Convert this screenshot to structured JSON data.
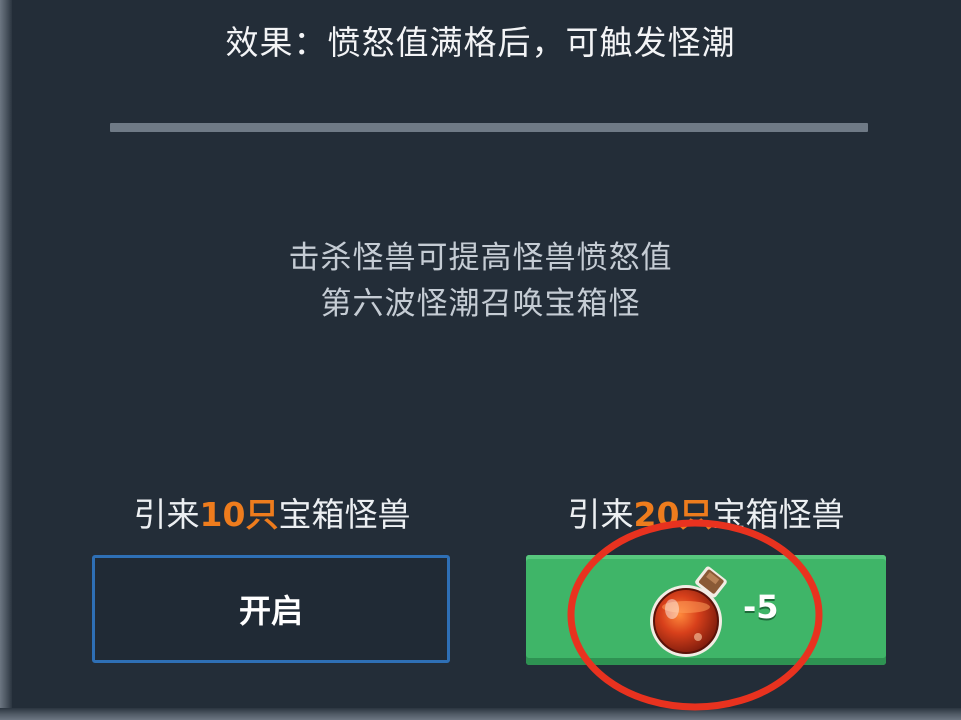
{
  "effect_text": "效果：愤怒值满格后，可触发怪潮",
  "description": {
    "line1": "击杀怪兽可提高怪兽愤怒值",
    "line2": "第六波怪潮召唤宝箱怪"
  },
  "option_left": {
    "prefix": "引来",
    "count": "10只",
    "suffix": "宝箱怪兽",
    "button_label": "开启"
  },
  "option_right": {
    "prefix": "引来",
    "count": "20只",
    "suffix": "宝箱怪兽",
    "cost_icon": "potion-icon",
    "cost": "-5"
  },
  "colors": {
    "background": "#232d38",
    "highlight": "#ee7c1d",
    "green_button": "#3fb568",
    "blue_border": "#2e6fb5",
    "annotation": "#e8321f"
  }
}
